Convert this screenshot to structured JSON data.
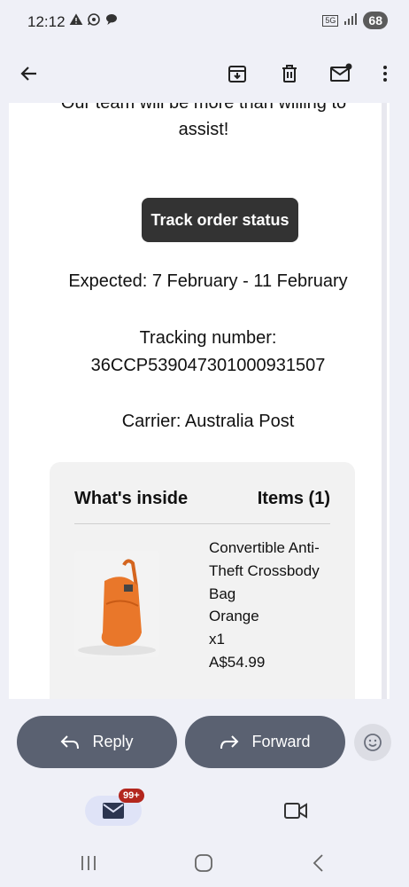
{
  "status_bar": {
    "time": "12:12",
    "network": "5G",
    "battery": "68",
    "notification_icons": [
      "warning-icon",
      "whatsapp-icon",
      "chat-bubble-icon"
    ]
  },
  "toolbar": {
    "back_icon": "arrow-back-icon",
    "archive_icon": "archive-icon",
    "delete_icon": "trash-icon",
    "mark_unread_icon": "mark-unread-icon",
    "more_icon": "more-vert-icon"
  },
  "email": {
    "cut_text": "Our team will be more than willing to",
    "assist_text": "assist!",
    "track_button": "Track order status",
    "expected": "Expected: 7 February - 11 February",
    "tracking_label": "Tracking number:",
    "tracking_number": "36CCP539047301000931507",
    "carrier": "Carrier: Australia Post",
    "inside": {
      "title": "What's inside",
      "items_label": "Items (1)",
      "product": {
        "name_line1": "Convertible Anti-",
        "name_line2": "Theft Crossbody",
        "name_line3": "Bag",
        "color": "Orange",
        "qty": "x1",
        "price": "A$54.99",
        "image_color": "#e9772a"
      }
    }
  },
  "actions": {
    "reply_label": "Reply",
    "forward_label": "Forward",
    "emoji_icon": "add-reaction-icon"
  },
  "bottom_nav": {
    "mail_badge": "99+",
    "mail_icon": "mail-icon",
    "video_icon": "videocam-icon"
  },
  "system_nav": {
    "recents_icon": "recents-icon",
    "home_icon": "home-icon",
    "back_icon": "back-chevron-icon"
  },
  "colors": {
    "accent_dark": "#333333",
    "pill": "#5a6171",
    "badge": "#b3261e"
  }
}
